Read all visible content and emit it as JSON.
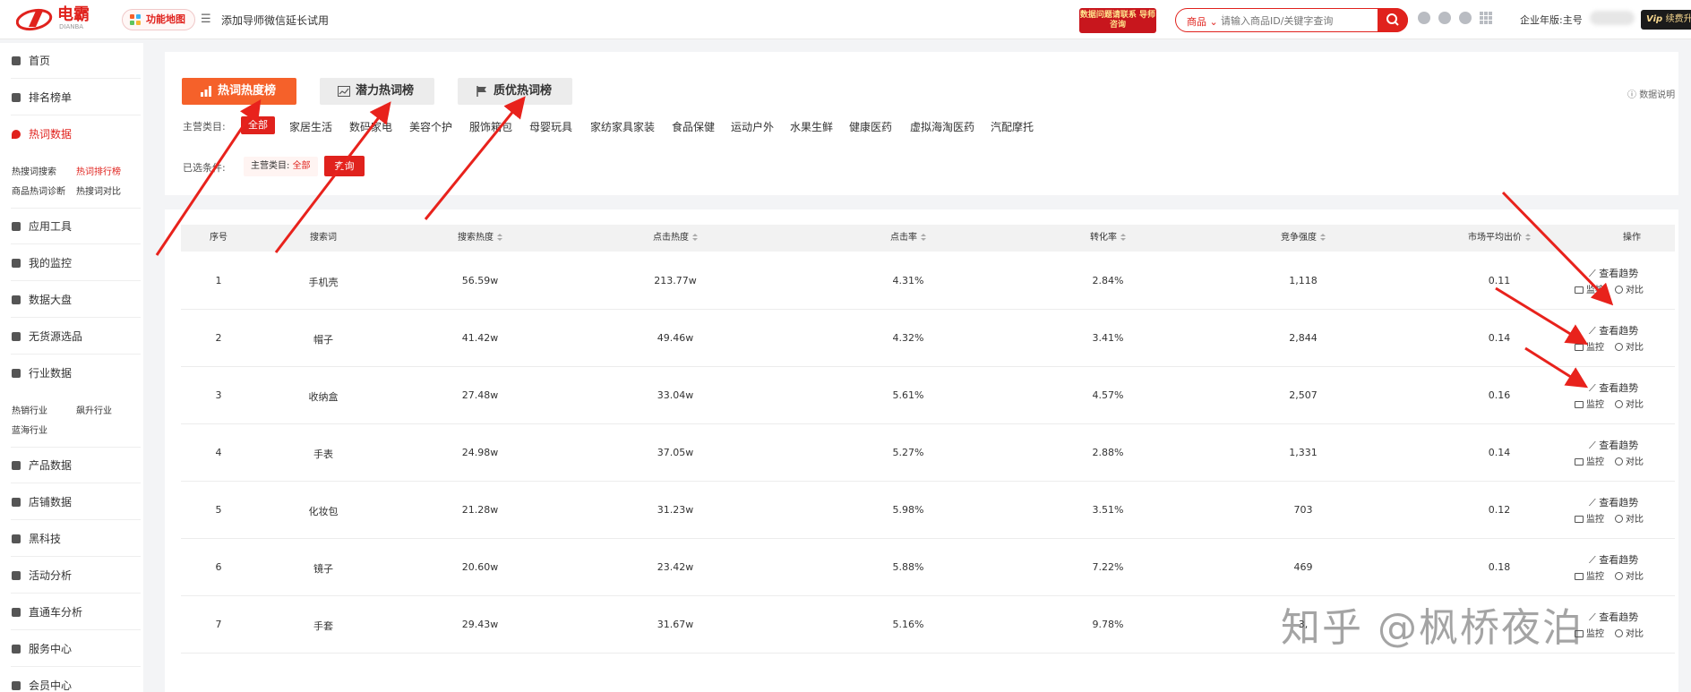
{
  "header": {
    "logo_text": "电霸",
    "logo_sub": "DIANBA",
    "function_map": "功能地图",
    "notice": "添加导师微信延长试用",
    "promo": "数据问题请联系 导师咨询",
    "search_category": "商品",
    "search_placeholder": "请输入商品ID/关键字查询",
    "account": "企业年版:主号",
    "vip": "续费升级"
  },
  "sidebar": {
    "items": [
      {
        "label": "首页"
      },
      {
        "label": "排名榜单"
      },
      {
        "label": "热词数据"
      },
      {
        "label": "应用工具"
      },
      {
        "label": "我的监控"
      },
      {
        "label": "数据大盘"
      },
      {
        "label": "无货源选品"
      },
      {
        "label": "行业数据"
      },
      {
        "label": "产品数据"
      },
      {
        "label": "店铺数据"
      },
      {
        "label": "黑科技"
      },
      {
        "label": "活动分析"
      },
      {
        "label": "直通车分析"
      },
      {
        "label": "服务中心"
      },
      {
        "label": "会员中心"
      }
    ],
    "hotword_sub": [
      "热搜词搜索",
      "热词排行榜",
      "商品热词诊断",
      "热搜词对比"
    ],
    "industry_sub": [
      "热销行业",
      "飙升行业",
      "蓝海行业"
    ]
  },
  "tabs": [
    "热词热度榜",
    "潜力热词榜",
    "质优热词榜"
  ],
  "data_note": "数据说明",
  "filter": {
    "category_label": "主营类目:",
    "all": "全部",
    "categories": [
      "家居生活",
      "数码家电",
      "美容个护",
      "服饰箱包",
      "母婴玩具",
      "家纺家具家装",
      "食品保健",
      "运动户外",
      "水果生鲜",
      "健康医药",
      "虚拟海淘医药",
      "汽配摩托"
    ],
    "selected_label": "已选条件:",
    "selected_chip_label": "主营类目:",
    "selected_chip_value": "全部",
    "query_button": "查询"
  },
  "table": {
    "headers": [
      "序号",
      "搜索词",
      "搜索热度",
      "点击热度",
      "点击率",
      "转化率",
      "竞争强度",
      "市场平均出价",
      "操作"
    ],
    "ops": {
      "trend": "查看趋势",
      "monitor": "监控",
      "compare": "对比"
    },
    "rows": [
      {
        "rank": "1",
        "keyword": "手机壳",
        "search_heat": "56.59w",
        "click_heat": "213.77w",
        "ctr": "4.31%",
        "cvr": "2.84%",
        "competition": "1,118",
        "avg_bid": "0.11"
      },
      {
        "rank": "2",
        "keyword": "帽子",
        "search_heat": "41.42w",
        "click_heat": "49.46w",
        "ctr": "4.32%",
        "cvr": "3.41%",
        "competition": "2,844",
        "avg_bid": "0.14"
      },
      {
        "rank": "3",
        "keyword": "收纳盒",
        "search_heat": "27.48w",
        "click_heat": "33.04w",
        "ctr": "5.61%",
        "cvr": "4.57%",
        "competition": "2,507",
        "avg_bid": "0.16"
      },
      {
        "rank": "4",
        "keyword": "手表",
        "search_heat": "24.98w",
        "click_heat": "37.05w",
        "ctr": "5.27%",
        "cvr": "2.88%",
        "competition": "1,331",
        "avg_bid": "0.14"
      },
      {
        "rank": "5",
        "keyword": "化妆包",
        "search_heat": "21.28w",
        "click_heat": "31.23w",
        "ctr": "5.98%",
        "cvr": "3.51%",
        "competition": "703",
        "avg_bid": "0.12"
      },
      {
        "rank": "6",
        "keyword": "镜子",
        "search_heat": "20.60w",
        "click_heat": "23.42w",
        "ctr": "5.88%",
        "cvr": "7.22%",
        "competition": "469",
        "avg_bid": "0.18"
      },
      {
        "rank": "7",
        "keyword": "手套",
        "search_heat": "29.43w",
        "click_heat": "31.67w",
        "ctr": "5.16%",
        "cvr": "9.78%",
        "competition": "3,",
        "avg_bid": ""
      }
    ]
  },
  "watermark": "知乎 @枫桥夜泊",
  "colors": {
    "brand": "#e0221d",
    "tab_active": "#f5612a",
    "arrow": "#e8221c"
  }
}
